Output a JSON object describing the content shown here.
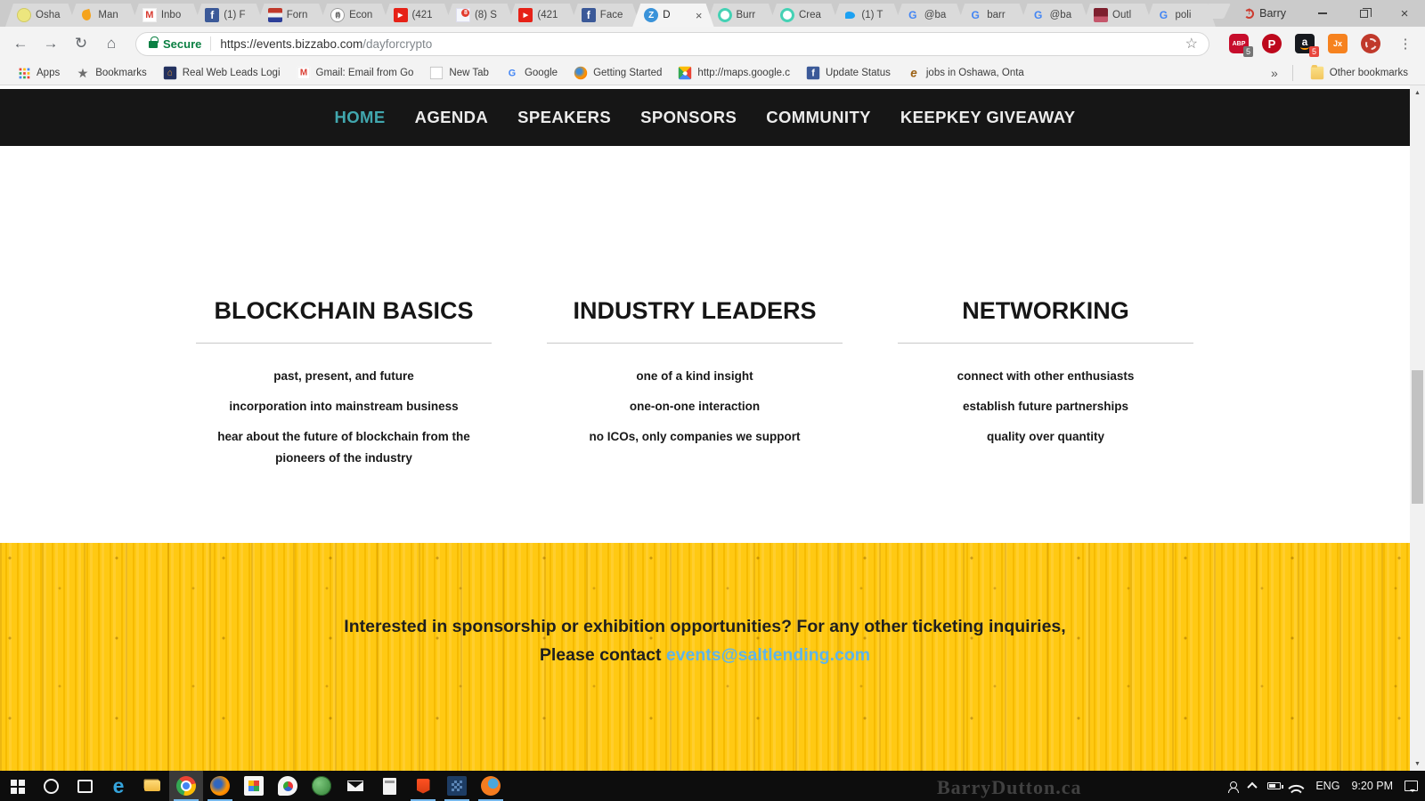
{
  "browser": {
    "profile_name": "Barry",
    "tabs": [
      {
        "title": "Osha",
        "icon": "osha"
      },
      {
        "title": "Man",
        "icon": "leaf"
      },
      {
        "title": "Inbo",
        "icon": "gmail"
      },
      {
        "title": "(1) F",
        "icon": "facebook"
      },
      {
        "title": "Forn",
        "icon": "news"
      },
      {
        "title": "Econ",
        "icon": "economist"
      },
      {
        "title": "(421",
        "icon": "youtube"
      },
      {
        "title": "(8) S",
        "icon": "badge8"
      },
      {
        "title": "(421",
        "icon": "youtube"
      },
      {
        "title": "Face",
        "icon": "facebook"
      },
      {
        "title": "D",
        "icon": "bizzabo",
        "active": true
      },
      {
        "title": "Burr",
        "icon": "teal"
      },
      {
        "title": "Crea",
        "icon": "teal"
      },
      {
        "title": "(1) T",
        "icon": "twitter"
      },
      {
        "title": "@ba",
        "icon": "google"
      },
      {
        "title": "barr",
        "icon": "google"
      },
      {
        "title": "@ba",
        "icon": "google"
      },
      {
        "title": "Outl",
        "icon": "maroon"
      },
      {
        "title": "poli",
        "icon": "google"
      }
    ],
    "address_bar": {
      "security_label": "Secure",
      "url_host": "https://events.bizzabo.com",
      "url_path": "/dayforcrypto"
    },
    "extensions": [
      {
        "name": "adblock-plus",
        "icon": "abp",
        "badge": "5",
        "badge_class": "badge-gray"
      },
      {
        "name": "pinterest",
        "icon": "pinterest"
      },
      {
        "name": "amazon-assistant",
        "icon": "amazon",
        "badge": "5",
        "badge_class": "badge-red"
      },
      {
        "name": "jx",
        "icon": "jx"
      },
      {
        "name": "red-dial",
        "icon": "reddial"
      }
    ],
    "bookmarks_bar": {
      "items": [
        {
          "label": "Apps",
          "icon": "appsgrid"
        },
        {
          "label": "Bookmarks",
          "icon": "graystar"
        },
        {
          "label": "Real Web Leads Logi",
          "icon": "house"
        },
        {
          "label": "Gmail: Email from Go",
          "icon": "gmail"
        },
        {
          "label": "New Tab",
          "icon": "page"
        },
        {
          "label": "Google",
          "icon": "google"
        },
        {
          "label": "Getting Started",
          "icon": "firefox"
        },
        {
          "label": "http://maps.google.c",
          "icon": "maps"
        },
        {
          "label": "Update Status",
          "icon": "facebook"
        },
        {
          "label": "jobs in Oshawa, Onta",
          "icon": "ie"
        }
      ],
      "overflow_chevron": "»",
      "other_bookmarks_label": "Other bookmarks"
    }
  },
  "site": {
    "accent_teal": "#41a7ae",
    "banner_bg": "#ffc60d",
    "email_link_color": "#5fb4e8",
    "nav_items": [
      {
        "label": "HOME",
        "active": true
      },
      {
        "label": "AGENDA"
      },
      {
        "label": "SPEAKERS"
      },
      {
        "label": "SPONSORS"
      },
      {
        "label": "COMMUNITY"
      },
      {
        "label": "KEEPKEY GIVEAWAY"
      }
    ],
    "columns": [
      {
        "heading": "BLOCKCHAIN BASICS",
        "item1": "past, present, and future",
        "item2": "incorporation into mainstream business",
        "item3": "hear about the future of blockchain from the pioneers of the industry"
      },
      {
        "heading": "INDUSTRY LEADERS",
        "item1": "one of a kind insight",
        "item2": "one-on-one interaction",
        "item3": "no ICOs, only companies we support"
      },
      {
        "heading": "NETWORKING",
        "item1": "connect with other enthusiasts",
        "item2": "establish future partnerships",
        "item3": "quality over quantity"
      }
    ],
    "banner": {
      "line1": "Interested in sponsorship or exhibition opportunities? For any other ticketing inquiries,",
      "line2_prefix": "Please contact ",
      "email": "events@saltlending.com"
    }
  },
  "taskbar": {
    "items": [
      {
        "name": "start",
        "icon": "start"
      },
      {
        "name": "search",
        "icon": "search"
      },
      {
        "name": "task-view",
        "icon": "taskview"
      },
      {
        "name": "edge",
        "icon": "edge"
      },
      {
        "name": "file-explorer",
        "icon": "folder"
      },
      {
        "name": "chrome",
        "icon": "chrome",
        "active": true,
        "running": true
      },
      {
        "name": "firefox",
        "icon": "firefox",
        "running": true
      },
      {
        "name": "tiles-app",
        "icon": "tiles"
      },
      {
        "name": "paint",
        "icon": "paint"
      },
      {
        "name": "globe-app",
        "icon": "globe"
      },
      {
        "name": "mail",
        "icon": "mail"
      },
      {
        "name": "calculator",
        "icon": "calc"
      },
      {
        "name": "brave",
        "icon": "brave",
        "running": true
      },
      {
        "name": "pixel-app",
        "icon": "pixel",
        "running": true
      },
      {
        "name": "shield-app",
        "icon": "shieldorange",
        "running": true
      }
    ],
    "tray": {
      "language": "ENG",
      "time": "9:20 PM"
    }
  },
  "watermark": "BarryDutton.ca"
}
